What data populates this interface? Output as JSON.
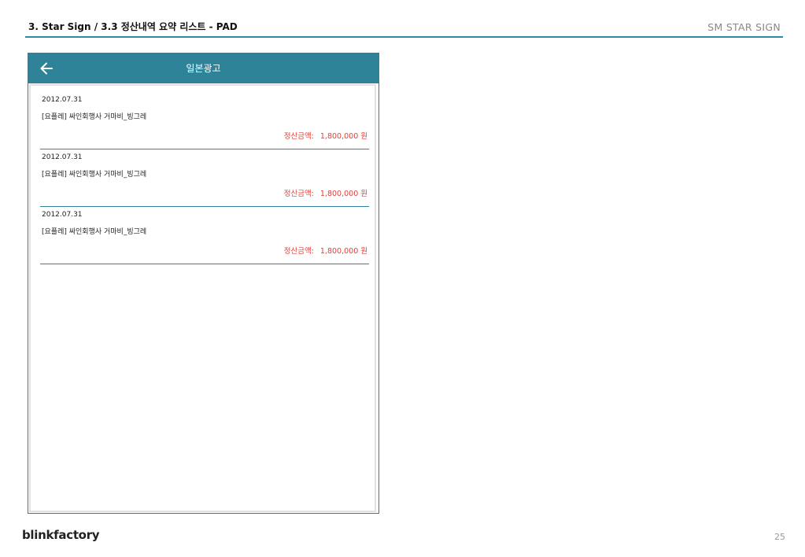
{
  "document": {
    "title": "3. Star Sign / 3.3 정산내역 요약 리스트 - PAD",
    "brand": "SM STAR SIGN",
    "footer_logo": "blinkfactory",
    "page_number": "25"
  },
  "app": {
    "title": "일본광고",
    "back_icon": "arrow-left-icon",
    "accent_color": "#2e8399",
    "amount_color": "#e0403a",
    "items": [
      {
        "date": "2012.07.31",
        "name": "[요플레] 싸인회행사 거마비_빙그레",
        "amount_label": "정산금액:",
        "amount_value": "1,800,000 원"
      },
      {
        "date": "2012.07.31",
        "name": "[요플레] 싸인회행사 거마비_빙그레",
        "amount_label": "정산금액:",
        "amount_value": "1,800,000 원"
      },
      {
        "date": "2012.07.31",
        "name": "[요플레] 싸인회행사 거마비_빙그레",
        "amount_label": "정산금액:",
        "amount_value": "1,800,000 원"
      }
    ]
  }
}
